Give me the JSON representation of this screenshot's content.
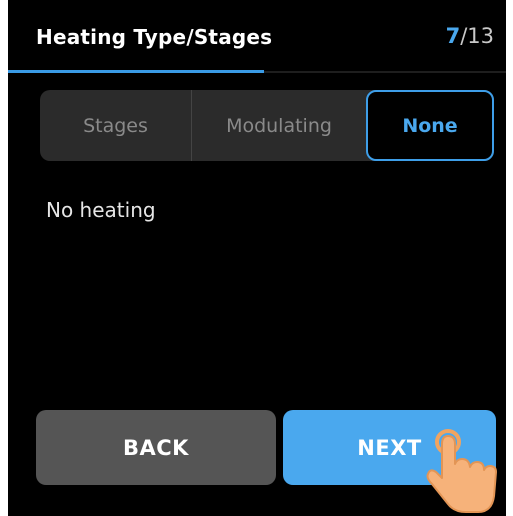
{
  "header": {
    "title": "Heating Type/Stages",
    "step_current": "7",
    "step_total": "/13",
    "progress": 0.515
  },
  "segmented_control": {
    "options": [
      "Stages",
      "Modulating",
      "None"
    ],
    "selected": "None"
  },
  "description": "No heating",
  "buttons": {
    "back_label": "BACK",
    "next_label": "NEXT"
  },
  "colors": {
    "accent": "#4aa8ee",
    "background": "#000000",
    "back_button": "#555555",
    "segment_bg": "#2b2b2b"
  },
  "icons": {
    "pointer": "tap-hand-icon"
  }
}
